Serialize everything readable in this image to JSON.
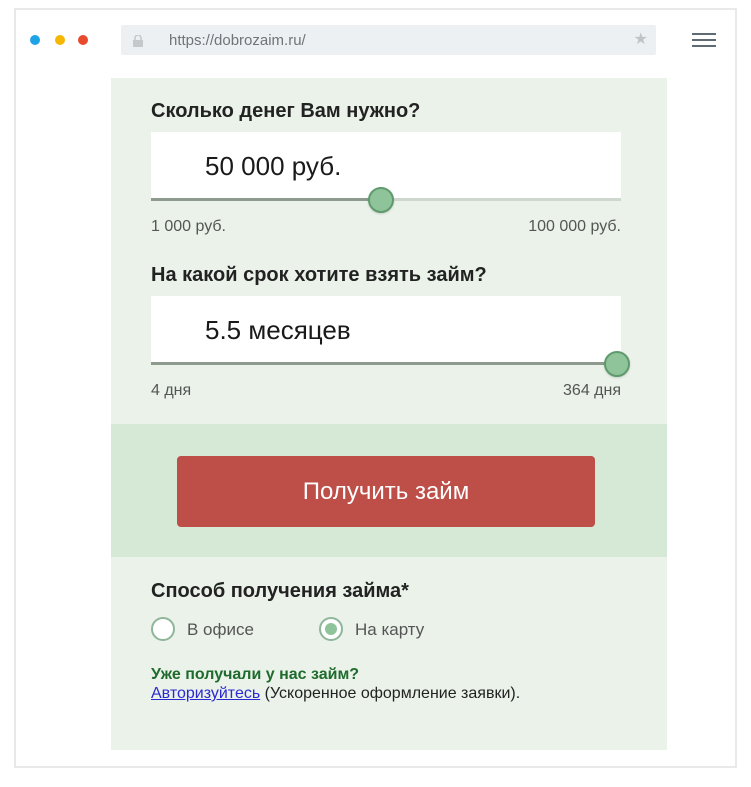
{
  "browser": {
    "url": "https://dobrozaim.ru/",
    "dots": {
      "blue": "#1fa2e6",
      "yellow": "#f5b700",
      "red": "#e84a2e"
    }
  },
  "amount": {
    "label": "Сколько денег Вам нужно?",
    "value": "50 000 руб.",
    "min_label": "1 000 руб.",
    "max_label": "100 000 руб.",
    "slider_fraction": 0.49
  },
  "term": {
    "label": "На какой срок хотите взять займ?",
    "value": "5.5 месяцев",
    "min_label": "4 дня",
    "max_label": "364 дня",
    "slider_fraction": 1.0
  },
  "cta": {
    "label": "Получить займ",
    "color": "#bd4e48"
  },
  "delivery": {
    "label": "Способ получения займа*",
    "options": [
      {
        "label": "В офисе",
        "selected": false
      },
      {
        "label": "На карту",
        "selected": true
      }
    ]
  },
  "returning": {
    "question": "Уже получали у нас займ?",
    "link": "Авторизуйтесь",
    "note": " (Ускоренное оформление заявки)."
  }
}
